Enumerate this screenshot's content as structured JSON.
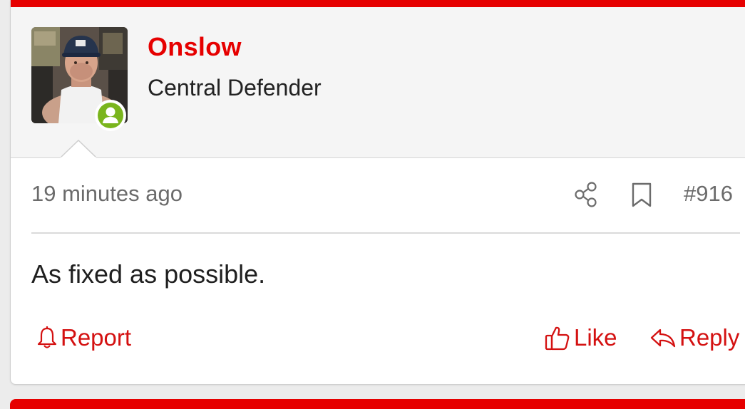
{
  "post": {
    "username": "Onslow",
    "user_title": "Central Defender",
    "online": true,
    "timestamp": "19 minutes ago",
    "post_number": "#916",
    "message": "As fixed as possible.",
    "icons": {
      "share": "share-icon",
      "bookmark": "bookmark-icon",
      "report": "bell-icon",
      "like": "thumbs-up-icon",
      "reply": "reply-arrow-icon",
      "online": "user-online-icon"
    },
    "actions": {
      "report_label": "Report",
      "like_label": "Like",
      "reply_label": "Reply"
    }
  },
  "colors": {
    "accent": "#e60000",
    "online": "#7ab51d",
    "meta_text": "#6b6b6b"
  }
}
